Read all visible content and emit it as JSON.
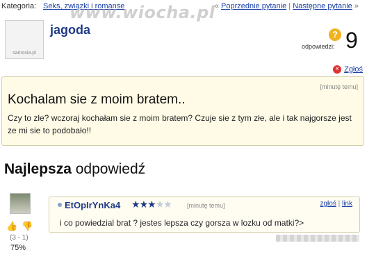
{
  "topbar": {
    "category_label": "Kategoria:",
    "category_link": "Seks, związki i romanse",
    "prev_label": "Poprzednie pytanie",
    "separator": "|",
    "next_label": "Następne pytanie",
    "prev_arrow": "«",
    "next_arrow": "»"
  },
  "watermark": "www.wiocha.pl",
  "question": {
    "author": "jagoda",
    "avatar_brand": "samosia.pl",
    "answers_label": "odpowiedzi:",
    "answers_count": "9",
    "answers_icon": "question-mark-icon",
    "report_label": "Zgłoś",
    "time": "[minutę temu]",
    "title": "Kochalam sie z moim bratem..",
    "body": "Czy to zle? wczoraj kochałam sie z moim bratem? Czuje sie z tym złe, ale i tak najgorsze jest ze mi sie to podobało!!"
  },
  "best_answer": {
    "heading_bold": "Najlepsza",
    "heading_rest": " odpowiedź",
    "author": "EtOpIrYnKa4",
    "rating_stars": 3,
    "rating_max": 5,
    "time": "[minutę temu]",
    "report_label": "zgłoś",
    "separator": "|",
    "link_label": "link",
    "text": "i co powiedzial brat ? jestes lepsza czy gorsza w lozku od matki?>",
    "votes": "(3 - 1)",
    "percent": "75%"
  },
  "colors": {
    "link": "#1a3fa8",
    "username": "#1f3a86",
    "box_bg": "#fffbe6",
    "icon_yellow": "#f0b31e"
  }
}
